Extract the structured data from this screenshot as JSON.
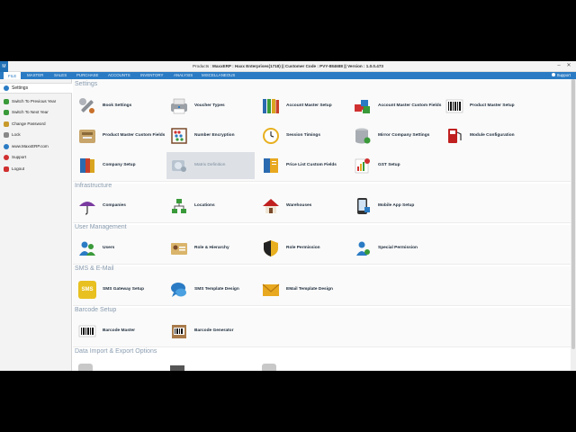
{
  "window": {
    "title_prefix": "Products : ",
    "title_bold": "MaxxERP : Haxx Enterprises(1718)  ||  Customer Code : PVY-884688  ||  Version : 1.0.0.473",
    "app_icon": "M",
    "minimize": "–",
    "close": "✕"
  },
  "menu": {
    "items": [
      "FILE",
      "MASTER",
      "SALES",
      "PURCHASE",
      "ACCOUNTS",
      "INVENTORY",
      "ANALYSIS",
      "MISCELLANEOUS"
    ],
    "support": "Support"
  },
  "sidebar": {
    "header": "Settings",
    "items": [
      {
        "label": "Switch To Previous Year",
        "icon": "arrow-left-icon",
        "color": "#3a9a3a"
      },
      {
        "label": "Switch To Next Year",
        "icon": "arrow-right-icon",
        "color": "#3a9a3a"
      },
      {
        "label": "Change Password",
        "icon": "key-icon",
        "color": "#c89a2a"
      },
      {
        "label": "Lock",
        "icon": "lock-icon",
        "color": "#888888"
      },
      {
        "label": "www.MaxxERP.com",
        "icon": "globe-icon",
        "color": "#2a7bc4"
      },
      {
        "label": "Support",
        "icon": "support-icon",
        "color": "#d03030"
      },
      {
        "label": "Logout",
        "icon": "logout-icon",
        "color": "#d03030"
      }
    ]
  },
  "sections": {
    "settings": {
      "title": "Settings",
      "tiles": [
        {
          "label": "Book Settings",
          "icon": "wrench-icon"
        },
        {
          "label": "Voucher Types",
          "icon": "printer-icon"
        },
        {
          "label": "Account Master Setup",
          "icon": "binders-icon"
        },
        {
          "label": "Account Master Custom Fields",
          "icon": "puzzle-icon"
        },
        {
          "label": "Product Master Setup",
          "icon": "barcode-icon"
        },
        {
          "label": "Product Master Custom Fields",
          "icon": "tools-box-icon"
        },
        {
          "label": "Number Encryption",
          "icon": "abacus-icon"
        },
        {
          "label": "Session Timings",
          "icon": "clock-icon"
        },
        {
          "label": "Mirror Company Settings",
          "icon": "database-icon"
        },
        {
          "label": "Module Configuration",
          "icon": "fuel-pump-icon"
        },
        {
          "label": "Company Setup",
          "icon": "books-icon"
        },
        {
          "label": "Matrix Definition",
          "icon": "matrix-icon"
        },
        {
          "label": "Price List Custom Fields",
          "icon": "price-list-icon"
        },
        {
          "label": "GST Setup",
          "icon": "gst-chart-icon"
        }
      ]
    },
    "infrastructure": {
      "title": "Infrastructure",
      "tiles": [
        {
          "label": "Companies",
          "icon": "umbrella-icon"
        },
        {
          "label": "Locations",
          "icon": "network-icon"
        },
        {
          "label": "Warehouses",
          "icon": "house-icon"
        },
        {
          "label": "Mobile App Setup",
          "icon": "mobile-icon"
        }
      ]
    },
    "user_management": {
      "title": "User Management",
      "tiles": [
        {
          "label": "Users",
          "icon": "users-icon"
        },
        {
          "label": "Role & Hierarchy",
          "icon": "id-card-icon"
        },
        {
          "label": "Role Permission",
          "icon": "shield-icon"
        },
        {
          "label": "Special Permission",
          "icon": "user-permission-icon"
        }
      ]
    },
    "sms_email": {
      "title": "SMS & E-Mail",
      "tiles": [
        {
          "label": "SMS Gateway Setup",
          "icon": "sms-icon",
          "icon_text": "SMS"
        },
        {
          "label": "SMS Template Design",
          "icon": "chat-icon"
        },
        {
          "label": "EMail Template Design",
          "icon": "envelope-icon"
        }
      ]
    },
    "barcode": {
      "title": "Barcode Setup",
      "tiles": [
        {
          "label": "Barcode Master",
          "icon": "barcode-master-icon"
        },
        {
          "label": "Barcode Generator",
          "icon": "barcode-generator-icon"
        }
      ]
    },
    "data_import": {
      "title": "Data Import & Export Options"
    }
  },
  "colors": {
    "menu_bar": "#2a7bc4",
    "section_heading": "#8a9db0",
    "hover_tile": "#dde1e6"
  }
}
